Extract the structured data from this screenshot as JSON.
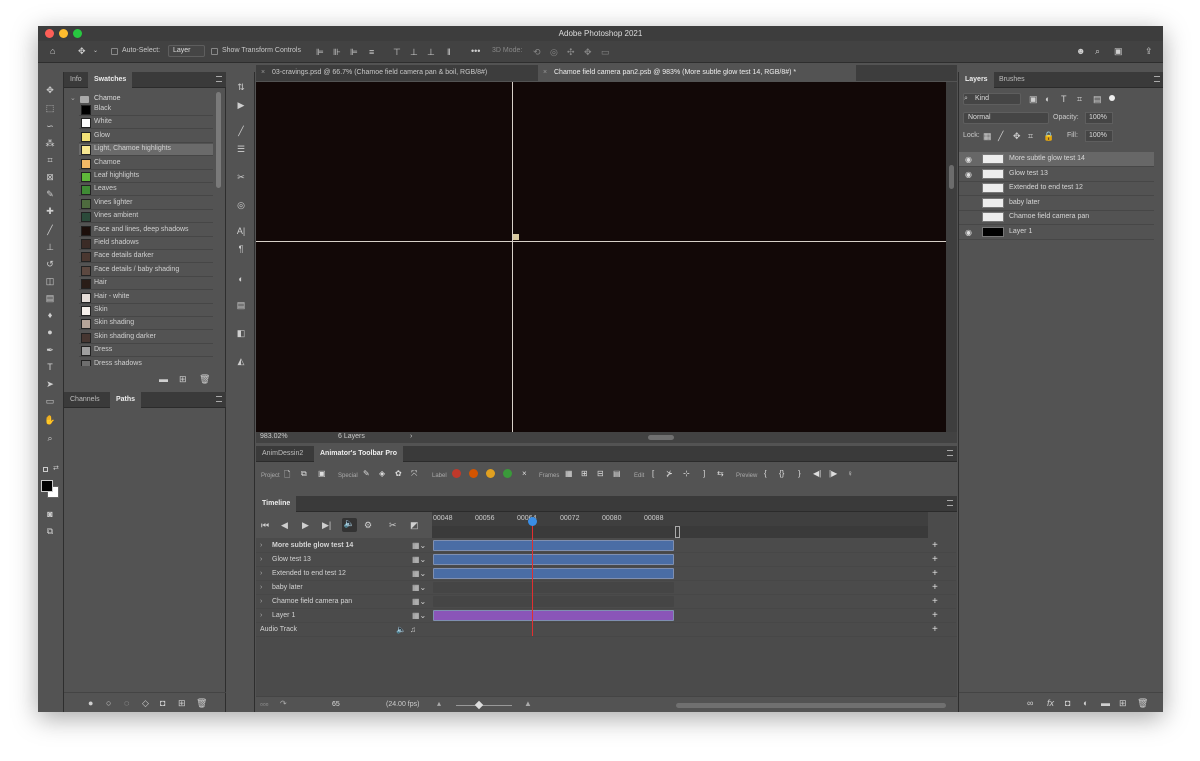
{
  "app": {
    "title": "Adobe Photoshop 2021"
  },
  "options_bar": {
    "auto_select_label": "Auto-Select:",
    "auto_select_value": "Layer",
    "transform_label": "Show Transform Controls",
    "mode_3d_label": "3D Mode:"
  },
  "left_panel": {
    "tabs": [
      "Info",
      "Swatches"
    ],
    "active_tab": "Swatches",
    "group_name": "Chamoe",
    "swatches": [
      {
        "name": "Black",
        "color": "#000000"
      },
      {
        "name": "White",
        "color": "#ffffff"
      },
      {
        "name": "Glow",
        "color": "#f3e277"
      },
      {
        "name": "Light, Chamoe highlights",
        "color": "#f7e792"
      },
      {
        "name": "Chamoe",
        "color": "#f2b866"
      },
      {
        "name": "Leaf highlights",
        "color": "#5fb83a"
      },
      {
        "name": "Leaves",
        "color": "#3f8a35"
      },
      {
        "name": "Vines lighter",
        "color": "#4e6b3e"
      },
      {
        "name": "Vines ambient",
        "color": "#2b4a3a"
      },
      {
        "name": "Face and lines, deep shadows",
        "color": "#1c0f0b"
      },
      {
        "name": "Field shadows",
        "color": "#3b2b26"
      },
      {
        "name": "Face details darker",
        "color": "#4a3730"
      },
      {
        "name": "Face details / baby shading",
        "color": "#5c4840"
      },
      {
        "name": "Hair",
        "color": "#2a1d17"
      },
      {
        "name": "Hair - white",
        "color": "#e5ddd8"
      },
      {
        "name": "Skin",
        "color": "#f7f1ec"
      },
      {
        "name": "Skin shading",
        "color": "#b5a498"
      },
      {
        "name": "Skin shading darker",
        "color": "#463631"
      },
      {
        "name": "Dress",
        "color": "#9f9f9f"
      },
      {
        "name": "Dress shadows",
        "color": "#6e6e6e"
      }
    ],
    "lower_tabs": [
      "Channels",
      "Paths"
    ],
    "lower_active": "Paths"
  },
  "document_tabs": [
    {
      "label": "03-cravings.psd @ 66.7% (Chamoe field camera pan & boil, RGB/8#)",
      "active": false
    },
    {
      "label": "Chamoe field camera pan2.psb @ 983% (More subtle glow test 14, RGB/8#) *",
      "active": true
    }
  ],
  "status": {
    "zoom": "983.02%",
    "layers": "6 Layers"
  },
  "animator": {
    "tabs": [
      "AnimDessin2",
      "Animator's Toolbar Pro"
    ],
    "active_tab": "Animator's Toolbar Pro",
    "labels": {
      "project": "Project",
      "special": "Special",
      "label": "Label",
      "frames": "Frames",
      "edit": "Edit",
      "preview": "Preview"
    },
    "label_colors": [
      "#c0392b",
      "#d35400",
      "#e0a020",
      "#3a9a3a"
    ]
  },
  "timeline": {
    "title": "Timeline",
    "ticks": [
      "00048",
      "00056",
      "00064",
      "00072",
      "00080",
      "00088"
    ],
    "tracks": [
      {
        "name": "More subtle glow test 14",
        "clip": "blue",
        "bold": true
      },
      {
        "name": "Glow test 13",
        "clip": "blue",
        "bold": false
      },
      {
        "name": "Extended to end test 12",
        "clip": "blue",
        "bold": false
      },
      {
        "name": "baby later",
        "clip": "none",
        "bold": false
      },
      {
        "name": "Chamoe field camera pan",
        "clip": "none",
        "bold": false
      },
      {
        "name": "Layer 1",
        "clip": "purple",
        "bold": false
      }
    ],
    "audio_track": "Audio Track",
    "current_frame": "65",
    "fps": "(24.00 fps)"
  },
  "layers_panel": {
    "tabs": [
      "Layers",
      "Brushes"
    ],
    "active_tab": "Layers",
    "filter": "Kind",
    "blend_mode": "Normal",
    "opacity_label": "Opacity:",
    "opacity": "100%",
    "lock_label": "Lock:",
    "fill_label": "Fill:",
    "fill": "100%",
    "layers": [
      {
        "name": "More subtle glow test 14",
        "visible": true,
        "selected": true,
        "thumb": "#ededed"
      },
      {
        "name": "Glow test 13",
        "visible": true,
        "selected": false,
        "thumb": "#ededed"
      },
      {
        "name": "Extended to end test 12",
        "visible": false,
        "selected": false,
        "thumb": "#ededed"
      },
      {
        "name": "baby later",
        "visible": false,
        "selected": false,
        "thumb": "#ededed"
      },
      {
        "name": "Chamoe field camera pan",
        "visible": false,
        "selected": false,
        "thumb": "#ededed"
      },
      {
        "name": "Layer 1",
        "visible": true,
        "selected": false,
        "thumb": "#000000"
      }
    ]
  }
}
